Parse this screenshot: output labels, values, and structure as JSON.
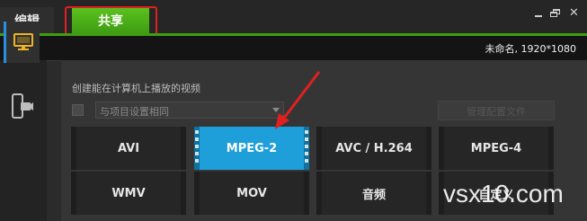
{
  "tabs": {
    "edit": "编辑",
    "share": "共享"
  },
  "project": {
    "info": "未命名, 1920*1080"
  },
  "panel": {
    "description": "创建能在计算机上播放的视频",
    "preset_select": "与项目设置相同",
    "ghost_button": "管理配置文件"
  },
  "formats": {
    "avi": "AVI",
    "mpeg2": "MPEG-2",
    "avc": "AVC / H.264",
    "mpeg4": "MPEG-4",
    "wmv": "WMV",
    "mov": "MOV",
    "audio": "音频",
    "custom": "自定义"
  },
  "watermark": "vsx10.com",
  "colors": {
    "accent_green": "#3f9d12",
    "selected_blue": "#1e9fd9",
    "annotation_red": "#e02020"
  },
  "icons": [
    "computer-icon",
    "device-icon",
    "minimize-icon",
    "restore-icon",
    "close-icon"
  ]
}
